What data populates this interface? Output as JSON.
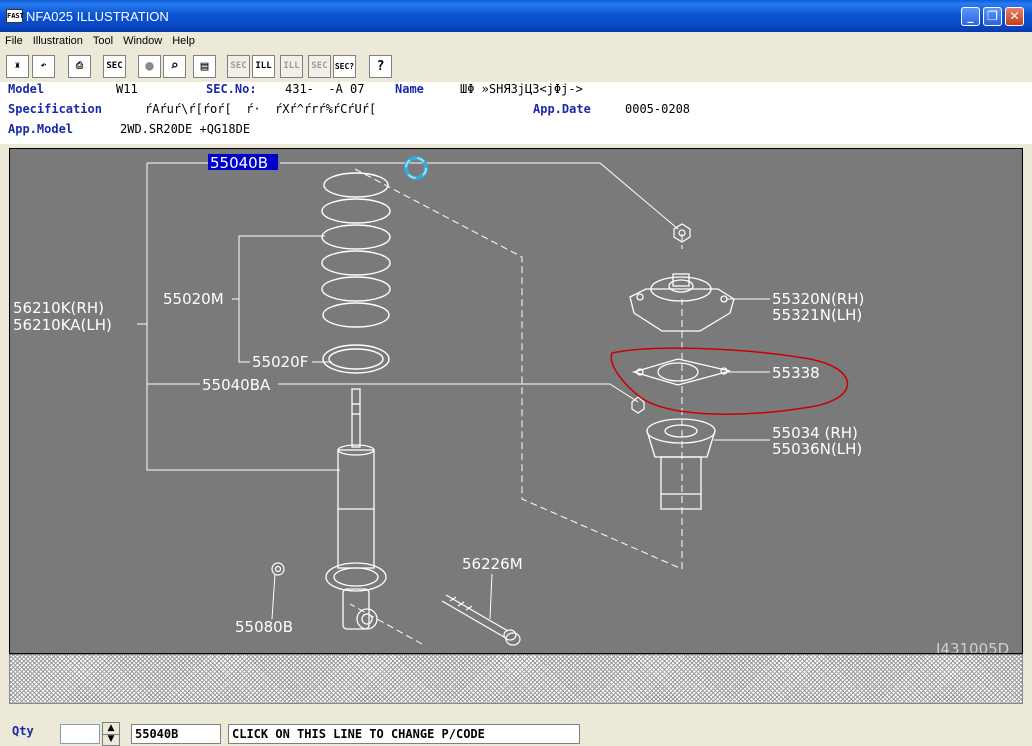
{
  "window": {
    "icon_text": "FAST",
    "title": "NFA025 ILLUSTRATION"
  },
  "menu": [
    "File",
    "Illustration",
    "Tool",
    "Window",
    "Help"
  ],
  "toolbar": {
    "buttons": [
      {
        "name": "parts-button",
        "icon": "parts-icon",
        "glyph": "♜",
        "disabled": false
      },
      {
        "name": "undo-button",
        "icon": "undo-icon",
        "glyph": "↶",
        "disabled": false
      },
      {
        "name": "print-button",
        "icon": "printer-icon",
        "glyph": "⎙",
        "disabled": false
      },
      {
        "name": "sec-list-button",
        "icon": "sec-list-icon",
        "glyph": "SEC",
        "disabled": false
      },
      {
        "name": "record-button",
        "icon": "circle-icon",
        "glyph": "●",
        "disabled": false
      },
      {
        "name": "zoom-button",
        "icon": "magnifier-icon",
        "glyph": "⌕",
        "disabled": false
      },
      {
        "name": "book-button",
        "icon": "book-icon",
        "glyph": "▤",
        "disabled": false
      },
      {
        "name": "prev-sec-button",
        "icon": "prev-sec-icon",
        "glyph": "SEC",
        "disabled": true
      },
      {
        "name": "ill-button",
        "icon": "ill-icon",
        "glyph": "ILL",
        "disabled": false
      },
      {
        "name": "next-ill-button",
        "icon": "next-ill-icon",
        "glyph": "ILL",
        "disabled": true
      },
      {
        "name": "next-sec-button",
        "icon": "next-sec-icon",
        "glyph": "SEC",
        "disabled": true
      },
      {
        "name": "sec-query-button",
        "icon": "sec-query-icon",
        "glyph": "SEC?",
        "disabled": false
      },
      {
        "name": "help-button",
        "icon": "help-icon",
        "glyph": "?",
        "disabled": false
      }
    ]
  },
  "info": {
    "model_label": "Model",
    "model_value": "W11",
    "sec_label": "SEC.No:",
    "sec_value": "431-  -A 07",
    "name_label": "Name",
    "name_value": "ШΦ »SHЯ3jЦ3<jΦj->",
    "spec_label": "Specification",
    "spec_value": "ŕAŕuŕ\\ŕ[ŕoŕ[  ŕ·  ŕXŕ^ŕrŕ%ŕCŕUŕ[",
    "appdate_label": "App.Date",
    "appdate_value": "0005-0208",
    "appmodel_label": "App.Model",
    "appmodel_value": "2WD.SR20DE +QG18DE"
  },
  "diagram": {
    "labels": {
      "p55040B": "55040B",
      "p56210K": "56210K(RH)",
      "p56210KA": "56210KA(LH)",
      "p55020M": "55020M",
      "p55020F": "55020F",
      "p55040BA": "55040BA",
      "p55320N": "55320N(RH)",
      "p55321N": "55321N(LH)",
      "p55338": "55338",
      "p55034": "55034 (RH)",
      "p55036N": "55036N(LH)",
      "p56226M": "56226M",
      "p55080B": "55080B",
      "ref": "J431005D"
    },
    "colors": {
      "background": "#7a7a7a",
      "line": "#ffffff",
      "highlight": "#0000cc",
      "circle": "#cc0000"
    }
  },
  "status": {
    "qty_label": "Qty",
    "qty_value": "",
    "part_code": "55040B",
    "change_line": "CLICK ON THIS LINE TO CHANGE P/CODE"
  }
}
